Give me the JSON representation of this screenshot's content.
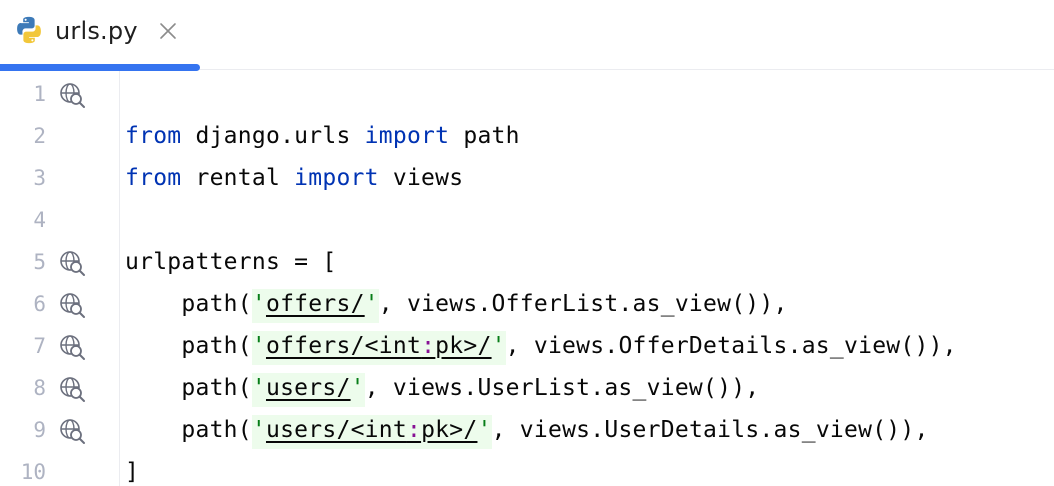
{
  "colors": {
    "tab_accent": "#3574f0",
    "keyword": "#0033b3",
    "string": "#067d17",
    "url_highlight_bg": "#edfcec",
    "line_number": "#aeb3c2"
  },
  "tab": {
    "icon": "python-file-icon",
    "title": "urls.py",
    "close_icon": "close-icon"
  },
  "editor": {
    "gutter_icon": "web-endpoint-search-icon",
    "lines": [
      {
        "number": "1"
      },
      {
        "number": "2",
        "kw1": "from",
        "mod": " django.urls ",
        "kw2": "import",
        "name": " path"
      },
      {
        "number": "3",
        "kw1": "from",
        "mod": " rental ",
        "kw2": "import",
        "name": " views"
      },
      {
        "number": "4"
      },
      {
        "number": "5",
        "text": "urlpatterns = ["
      },
      {
        "number": "6",
        "prefix": "    path(",
        "q1": "'",
        "url": "offers/",
        "url_a": "",
        "url_colon": "",
        "url_b": "",
        "q2": "'",
        "rest": ", views.OfferList.as_view()),"
      },
      {
        "number": "7",
        "prefix": "    path(",
        "q1": "'",
        "url": "offers/<int",
        "url_colon": ":",
        "url_b": "pk>/",
        "q2": "'",
        "rest": ", views.OfferDetails.as_view()),"
      },
      {
        "number": "8",
        "prefix": "    path(",
        "q1": "'",
        "url": "users/",
        "url_colon": "",
        "url_b": "",
        "q2": "'",
        "rest": ", views.UserList.as_view()),"
      },
      {
        "number": "9",
        "prefix": "    path(",
        "q1": "'",
        "url": "users/<int",
        "url_colon": ":",
        "url_b": "pk>/",
        "q2": "'",
        "rest": ", views.UserDetails.as_view()),"
      },
      {
        "number": "10",
        "text": "]"
      }
    ]
  }
}
